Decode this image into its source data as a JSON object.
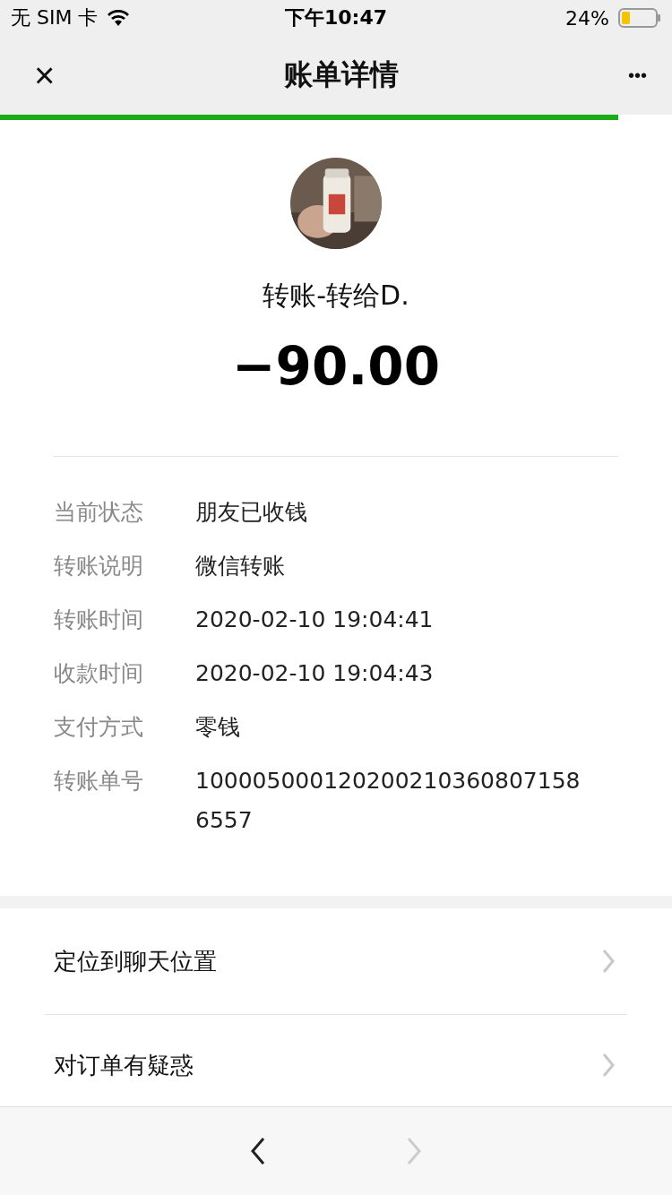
{
  "status_bar": {
    "carrier": "无 SIM 卡",
    "time": "下午10:47",
    "battery": "24%"
  },
  "nav": {
    "close": "×",
    "title": "账单详情",
    "more": "•••"
  },
  "progress": {
    "level": 0.92
  },
  "bill": {
    "title": "转账-转给D.",
    "amount": "−90.00"
  },
  "details": [
    {
      "label": "当前状态",
      "value": "朋友已收钱"
    },
    {
      "label": "转账说明",
      "value": "微信转账"
    },
    {
      "label": "转账时间",
      "value": "2020-02-10 19:04:41"
    },
    {
      "label": "收款时间",
      "value": "2020-02-10 19:04:43"
    },
    {
      "label": "支付方式",
      "value": "零钱"
    },
    {
      "label": "转账单号",
      "value": "1000050001202002103608071586557"
    }
  ],
  "actions": [
    {
      "label": "定位到聊天位置"
    },
    {
      "label": "对订单有疑惑"
    }
  ],
  "toolbar": {
    "back_disabled": false,
    "forward_disabled": true
  }
}
